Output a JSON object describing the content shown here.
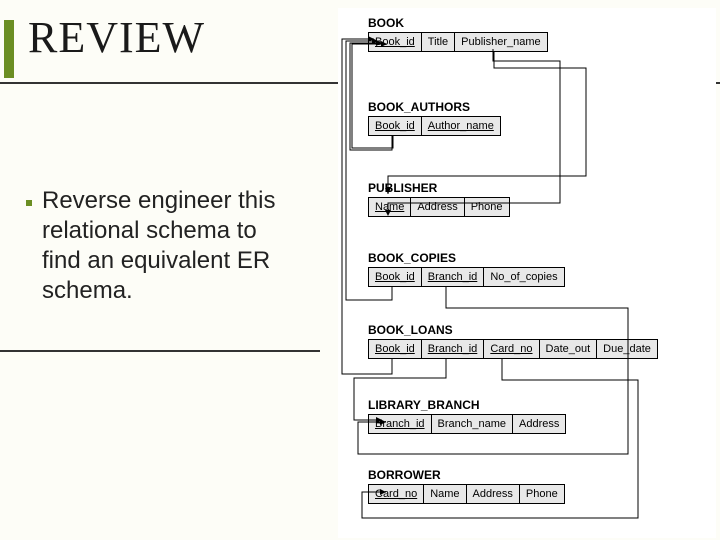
{
  "title": "REVIEW",
  "body": "Reverse engineer this relational schema to find an equivalent ER schema.",
  "tables": {
    "book": {
      "name": "BOOK",
      "cols": {
        "c0": "Book_id",
        "c1": "Title",
        "c2": "Publisher_name"
      }
    },
    "book_authors": {
      "name": "BOOK_AUTHORS",
      "cols": {
        "c0": "Book_id",
        "c1": "Author_name"
      }
    },
    "publisher": {
      "name": "PUBLISHER",
      "cols": {
        "c0": "Name",
        "c1": "Address",
        "c2": "Phone"
      }
    },
    "book_copies": {
      "name": "BOOK_COPIES",
      "cols": {
        "c0": "Book_id",
        "c1": "Branch_id",
        "c2": "No_of_copies"
      }
    },
    "book_loans": {
      "name": "BOOK_LOANS",
      "cols": {
        "c0": "Book_id",
        "c1": "Branch_id",
        "c2": "Card_no",
        "c3": "Date_out",
        "c4": "Due_date"
      }
    },
    "library_branch": {
      "name": "LIBRARY_BRANCH",
      "cols": {
        "c0": "Branch_id",
        "c1": "Branch_name",
        "c2": "Address"
      }
    },
    "borrower": {
      "name": "BORROWER",
      "cols": {
        "c0": "Card_no",
        "c1": "Name",
        "c2": "Address",
        "c3": "Phone"
      }
    }
  }
}
